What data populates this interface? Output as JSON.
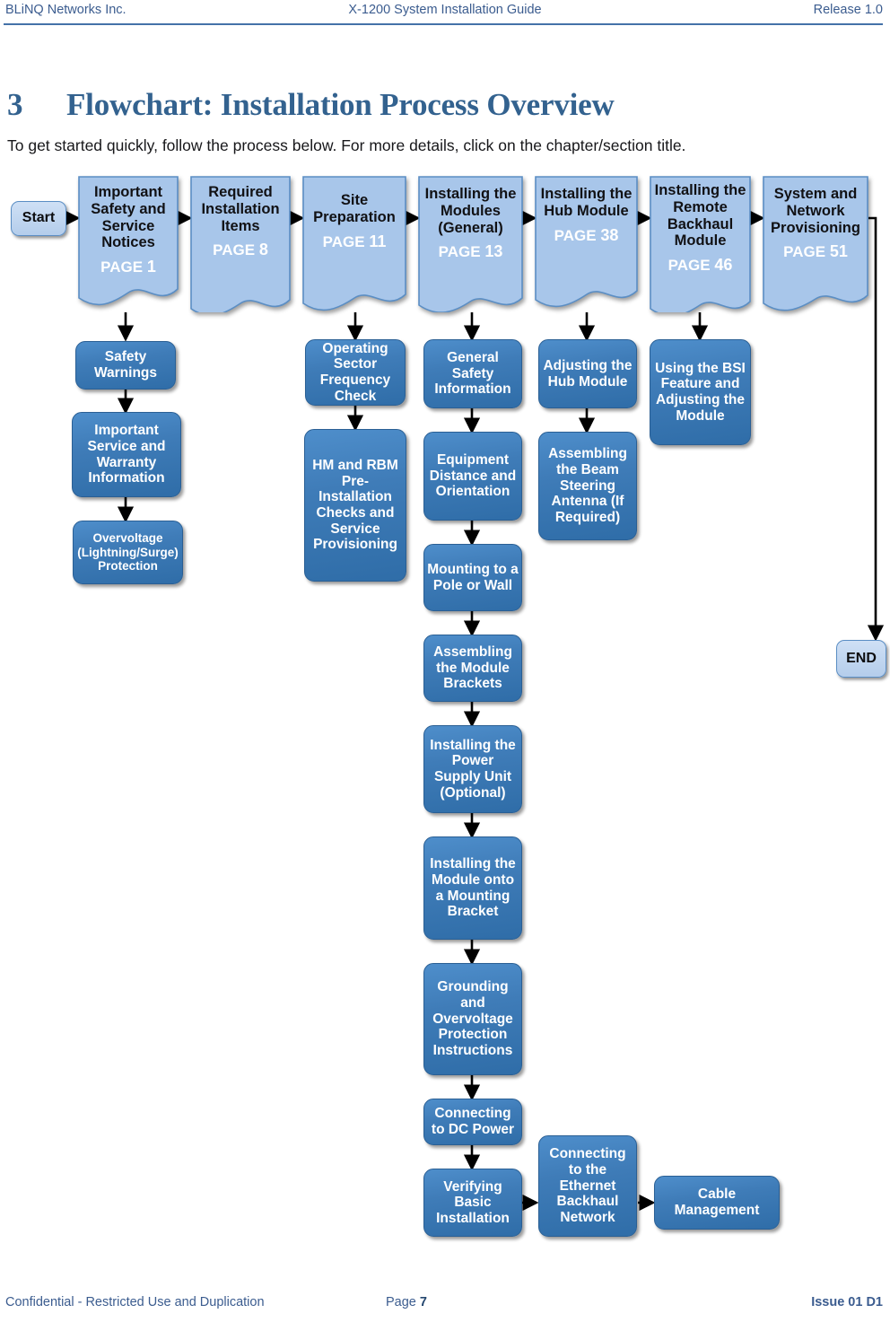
{
  "header": {
    "left": "BLiNQ Networks Inc.",
    "center": "X-1200 System Installation Guide",
    "right": "Release 1.0"
  },
  "title": {
    "number": "3",
    "text": "Flowchart: Installation Process Overview"
  },
  "intro": "To get started quickly, follow the process below. For more details, click on the chapter/section title.",
  "flowchart": {
    "start": {
      "label": "Start"
    },
    "end": {
      "label": "END"
    },
    "chapters": [
      {
        "label": "Important Safety and Service Notices",
        "page_prefix": "PAGE",
        "page": "1"
      },
      {
        "label": "Required Installation Items",
        "page_prefix": "PAGE",
        "page": "8"
      },
      {
        "label": "Site Preparation",
        "page_prefix": "PAGE",
        "page": "11"
      },
      {
        "label": "Installing the Modules (General)",
        "page_prefix": "PAGE",
        "page": "13"
      },
      {
        "label": "Installing the Hub Module",
        "page_prefix": "PAGE",
        "page": "38"
      },
      {
        "label": "Installing the Remote Backhaul Module",
        "page_prefix": "PAGE",
        "page": "46"
      },
      {
        "label": "System and Network Provisioning",
        "page_prefix": "PAGE",
        "page": "51"
      }
    ],
    "sections": {
      "safety": [
        {
          "label": "Safety Warnings"
        },
        {
          "label": "Important Service and Warranty Information"
        },
        {
          "label": "Overvoltage (Lightning/Surge) Protection"
        }
      ],
      "site_preparation": [
        {
          "label": "Operating Sector Frequency Check"
        },
        {
          "label": "HM and RBM Pre-Installation Checks and Service Provisioning"
        }
      ],
      "modules_general": [
        {
          "label": "General Safety Information"
        },
        {
          "label": "Equipment Distance and Orientation"
        },
        {
          "label": "Mounting to a Pole or Wall"
        },
        {
          "label": "Assembling the Module Brackets"
        },
        {
          "label": "Installing the Power Supply Unit (Optional)"
        },
        {
          "label": "Installing the Module onto a Mounting Bracket"
        },
        {
          "label": "Grounding and Overvoltage Protection Instructions"
        },
        {
          "label": "Connecting to DC Power"
        },
        {
          "label": "Verifying Basic Installation"
        }
      ],
      "hub_module": [
        {
          "label": "Adjusting the Hub Module"
        },
        {
          "label": "Assembling the Beam Steering Antenna (If Required)"
        }
      ],
      "remote_backhaul": [
        {
          "label": "Using the BSI Feature and Adjusting the Module"
        }
      ],
      "bottom_chain": [
        {
          "label": "Connecting to the Ethernet Backhaul Network"
        },
        {
          "label": "Cable Management"
        }
      ]
    }
  },
  "footer": {
    "left": "Confidential - Restricted Use and Duplication",
    "page_label": "Page",
    "page_number": "7",
    "right": "Issue 01 D1"
  },
  "colors": {
    "header_blue": "#3b5c8f",
    "title_blue": "#33628f",
    "chapter_fill": "#a8c6ea",
    "chapter_stroke": "#5b8ec4",
    "section_fill": "#3a78b4",
    "terminator_fill": "#bed4ee"
  }
}
